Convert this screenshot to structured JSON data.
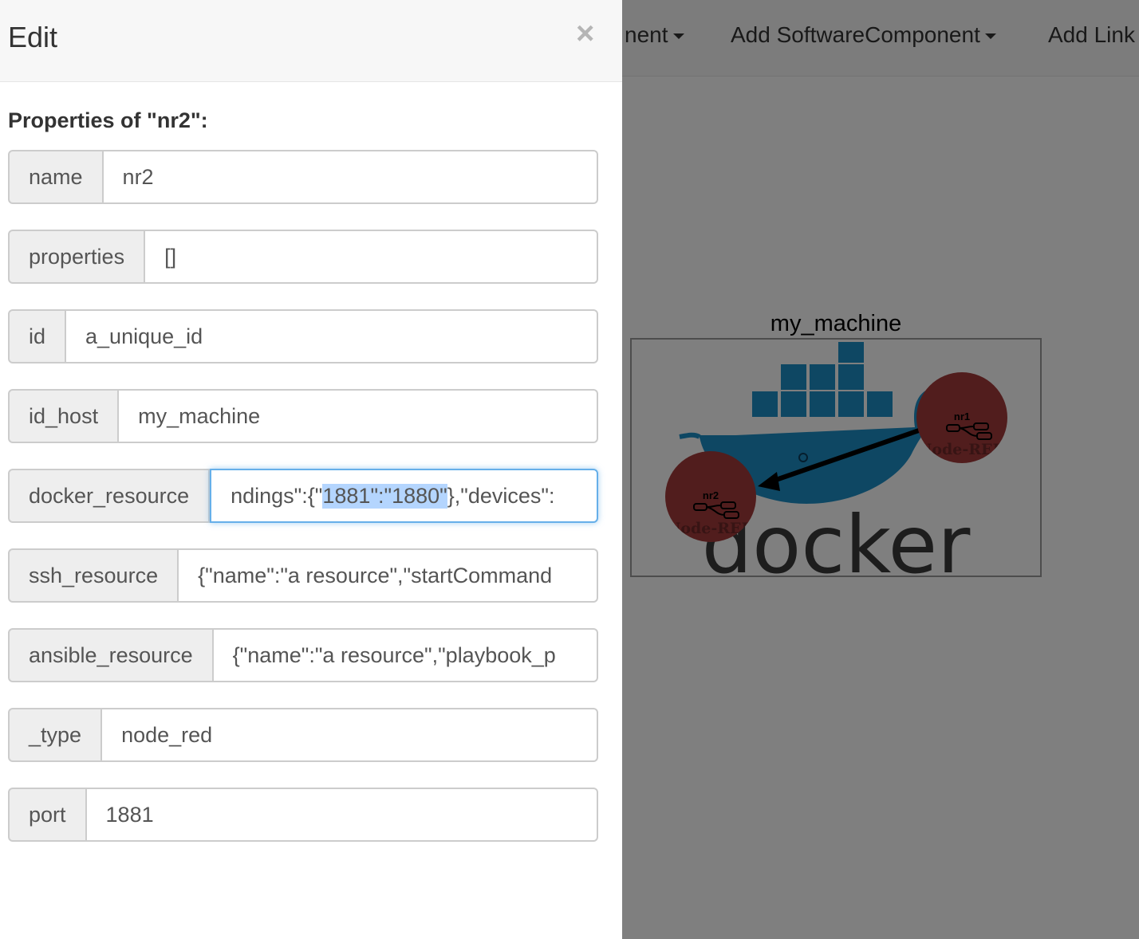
{
  "app": {
    "menu": [
      {
        "label": "nent"
      },
      {
        "label": "Add SoftwareComponent"
      },
      {
        "label": "Add Link"
      }
    ],
    "machine": {
      "label": "my_machine",
      "logo_text": "docker"
    },
    "nodes": {
      "nr1": {
        "label": "nr1",
        "sub": "Node-RED"
      },
      "nr2": {
        "label": "nr2",
        "sub": "Node-RED"
      }
    }
  },
  "modal": {
    "title": "Edit",
    "close": "×",
    "subtitle": "Properties of \"nr2\":",
    "fields": [
      {
        "key": "name",
        "value": "nr2"
      },
      {
        "key": "properties",
        "value": "[]"
      },
      {
        "key": "id",
        "value": "a_unique_id"
      },
      {
        "key": "id_host",
        "value": "my_machine"
      },
      {
        "key": "docker_resource",
        "value_before": "ndings\":{\"",
        "value_selected": "1881\":\"1880\"",
        "value_after": "},\"devices\":"
      },
      {
        "key": "ssh_resource",
        "value": "{\"name\":\"a resource\",\"startCommand"
      },
      {
        "key": "ansible_resource",
        "value": "{\"name\":\"a resource\",\"playbook_p"
      },
      {
        "key": "_type",
        "value": "node_red"
      },
      {
        "key": "port",
        "value": "1881"
      }
    ]
  },
  "colors": {
    "node_fill": "#a23a3a",
    "focus_border": "#66afe9",
    "selection": "#b4d5fe",
    "overlay": "rgba(0,0,0,0.5)"
  }
}
